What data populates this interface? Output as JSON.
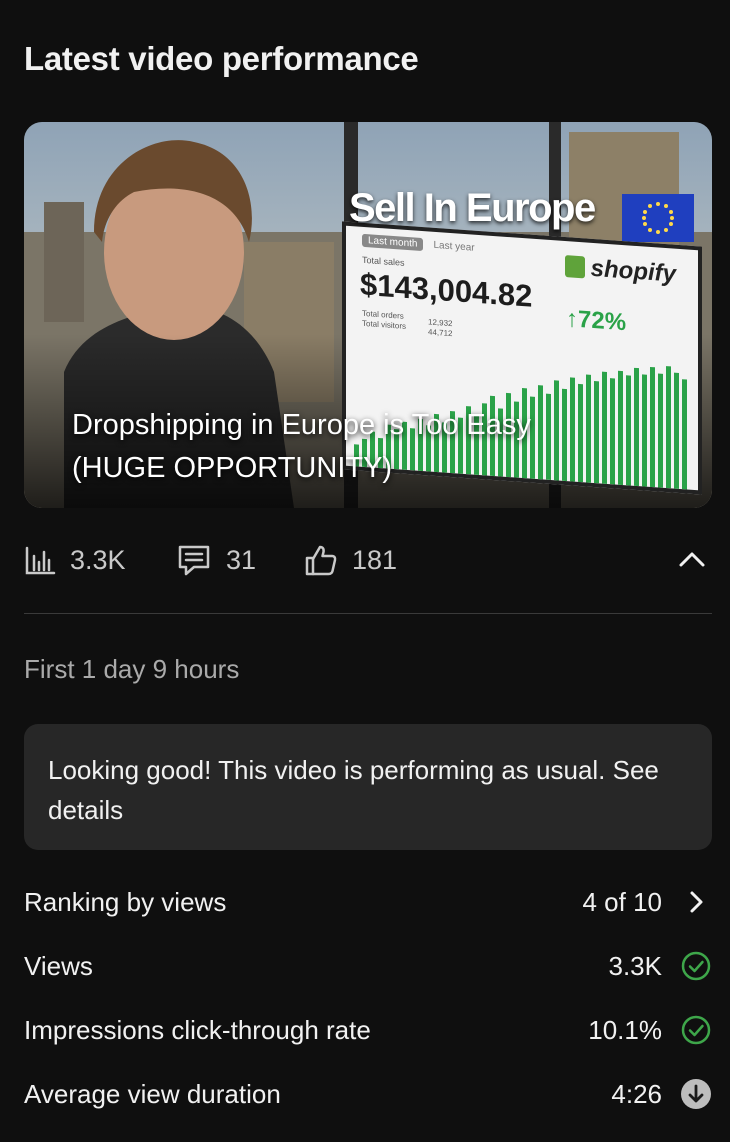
{
  "card": {
    "title": "Latest video performance"
  },
  "thumbnail": {
    "headline": "Sell In Europe",
    "video_title": "Dropshipping in Europe is Too Easy (HUGE OPPORTUNITY)",
    "screen": {
      "tab_active": "Last month",
      "tab_other": "Last year",
      "sales_label": "Total sales",
      "sales_value": "$143,004.82",
      "growth": "↑72%",
      "brand": "shopify",
      "meta_labels": [
        "Total orders",
        "Total visitors"
      ],
      "meta_values": [
        "12,932",
        "44,712"
      ]
    }
  },
  "stats": {
    "views": "3.3K",
    "comments": "31",
    "likes": "181"
  },
  "period": "First 1 day 9 hours",
  "notice": "Looking good! This video is performing as usual. See details",
  "metrics": [
    {
      "label": "Ranking by views",
      "value": "4 of 10",
      "icon": "chevron-right-icon"
    },
    {
      "label": "Views",
      "value": "3.3K",
      "icon": "check-circle-icon"
    },
    {
      "label": "Impressions click-through rate",
      "value": "10.1%",
      "icon": "check-circle-icon"
    },
    {
      "label": "Average view duration",
      "value": "4:26",
      "icon": "arrow-down-circle-icon"
    }
  ],
  "colors": {
    "good": "#3ea64a",
    "background": "#0f0f0f",
    "panel": "#272727"
  }
}
